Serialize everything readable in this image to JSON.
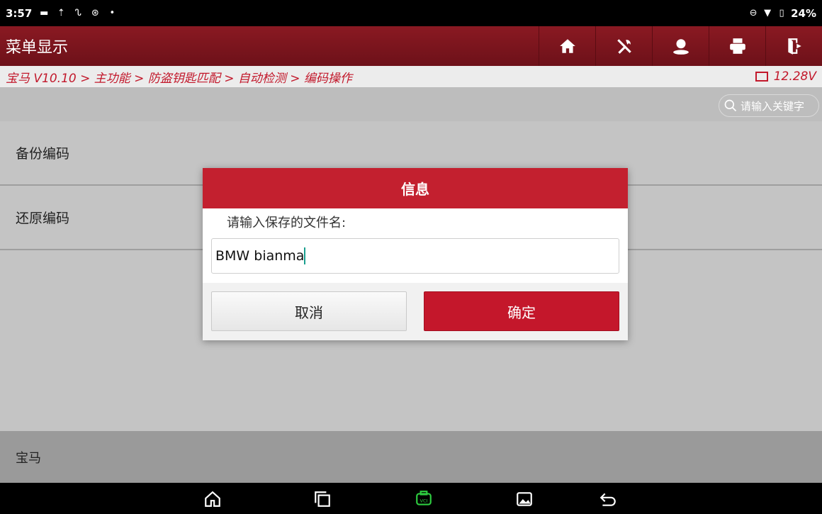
{
  "status_bar": {
    "time": "3:57",
    "battery": "24%"
  },
  "titlebar": {
    "title": "菜单显示",
    "icons": [
      "home-icon",
      "tools-icon",
      "user-icon",
      "printer-icon",
      "exit-icon"
    ]
  },
  "breadcrumb": {
    "path": "宝马 V10.10 > 主功能 > 防盗钥匙匹配 > 自动检测 > 编码操作",
    "voltage": "12.28V"
  },
  "search": {
    "placeholder": "请输入关键字"
  },
  "menu": {
    "items": [
      {
        "label": "备份编码"
      },
      {
        "label": "还原编码"
      }
    ]
  },
  "footer": {
    "label": "宝马"
  },
  "dialog": {
    "title": "信息",
    "prompt": "请输入保存的文件名:",
    "input_value": "BMW bianma",
    "cancel_label": "取消",
    "ok_label": "确定"
  },
  "colors": {
    "accent": "#c3202f",
    "titlebar": "#7a141c"
  }
}
